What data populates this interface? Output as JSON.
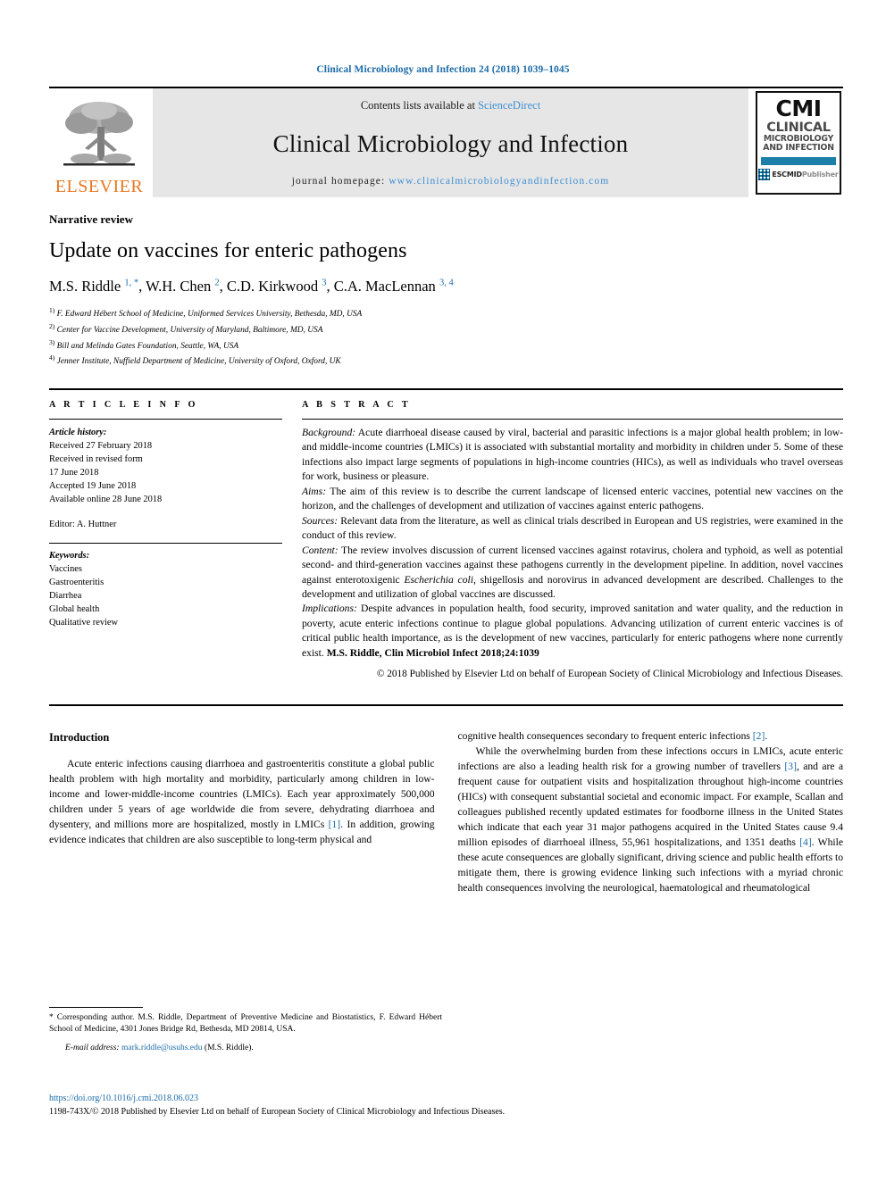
{
  "running_head": "Clinical Microbiology and Infection 24 (2018) 1039–1045",
  "masthead": {
    "publisher_logo_text": "ELSEVIER",
    "contents_prefix": "Contents lists available at ",
    "contents_link": "ScienceDirect",
    "journal_name": "Clinical Microbiology and Infection",
    "homepage_prefix": "journal homepage: ",
    "homepage_url": "www.clinicalmicrobiologyandinfection.com",
    "cmi_logo": {
      "acronym": "CMI",
      "line1": "CLINICAL",
      "line2": "MICROBIOLOGY",
      "line3": "AND INFECTION",
      "society": "ESCMID",
      "society_suffix": "Publisher"
    }
  },
  "article": {
    "kicker": "Narrative review",
    "title": "Update on vaccines for enteric pathogens",
    "authors_html": "M.S. Riddle, W.H. Chen, C.D. Kirkwood, C.A. MacLennan",
    "author_list": [
      {
        "name": "M.S. Riddle",
        "marks": "1, *"
      },
      {
        "name": "W.H. Chen",
        "marks": "2"
      },
      {
        "name": "C.D. Kirkwood",
        "marks": "3"
      },
      {
        "name": "C.A. MacLennan",
        "marks": "3, 4"
      }
    ],
    "affiliations": [
      {
        "num": "1)",
        "text": "F. Edward Hébert School of Medicine, Uniformed Services University, Bethesda, MD, USA"
      },
      {
        "num": "2)",
        "text": "Center for Vaccine Development, University of Maryland, Baltimore, MD, USA"
      },
      {
        "num": "3)",
        "text": "Bill and Melinda Gates Foundation, Seattle, WA, USA"
      },
      {
        "num": "4)",
        "text": "Jenner Institute, Nuffield Department of Medicine, University of Oxford, Oxford, UK"
      }
    ]
  },
  "article_info": {
    "heading": "A R T I C L E   I N F O",
    "history_label": "Article history:",
    "history_lines": [
      "Received 27 February 2018",
      "Received in revised form",
      "17 June 2018",
      "Accepted 19 June 2018",
      "Available online 28 June 2018"
    ],
    "editor": "Editor: A. Huttner",
    "keywords_label": "Keywords:",
    "keywords": [
      "Vaccines",
      "Gastroenteritis",
      "Diarrhea",
      "Global health",
      "Qualitative review"
    ]
  },
  "abstract": {
    "heading": "A B S T R A C T",
    "background_label": "Background:",
    "background": " Acute diarrhoeal disease caused by viral, bacterial and parasitic infections is a major global health problem; in low- and middle-income countries (LMICs) it is associated with substantial mortality and morbidity in children under 5. Some of these infections also impact large segments of populations in high-income countries (HICs), as well as individuals who travel overseas for work, business or pleasure.",
    "aims_label": "Aims:",
    "aims": " The aim of this review is to describe the current landscape of licensed enteric vaccines, potential new vaccines on the horizon, and the challenges of development and utilization of vaccines against enteric pathogens.",
    "sources_label": "Sources:",
    "sources": " Relevant data from the literature, as well as clinical trials described in European and US registries, were examined in the conduct of this review.",
    "content_label": "Content:",
    "content_part1": " The review involves discussion of current licensed vaccines against rotavirus, cholera and typhoid, as well as potential second- and third-generation vaccines against these pathogens currently in the development pipeline. In addition, novel vaccines against enterotoxigenic ",
    "content_italic": "Escherichia coli",
    "content_part2": ", shigellosis and norovirus in advanced development are described. Challenges to the development and utilization of global vaccines are discussed.",
    "implications_label": "Implications:",
    "implications": " Despite advances in population health, food security, improved sanitation and water quality, and the reduction in poverty, acute enteric infections continue to plague global populations. Advancing utilization of current enteric vaccines is of critical public health importance, as is the development of new vaccines, particularly for enteric pathogens where none currently exist. ",
    "citation_bold": "M.S. Riddle, Clin Microbiol Infect 2018;24:1039",
    "copyright": "© 2018 Published by Elsevier Ltd on behalf of European Society of Clinical Microbiology and Infectious Diseases."
  },
  "body": {
    "section_heading": "Introduction",
    "left_column": [
      {
        "parts": [
          {
            "t": "Acute enteric infections causing diarrhoea and gastroenteritis constitute a global public health problem with high mortality and morbidity, particularly among children in low-income and lower-middle-income countries (LMICs). Each year approximately 500,000 children under 5 years of age worldwide die from severe, dehydrating diarrhoea and dysentery, and millions more are hospitalized, mostly in LMICs ",
            "k": "text"
          },
          {
            "t": "[1]",
            "k": "ref"
          },
          {
            "t": ". In addition, growing evidence indicates that children are also susceptible to long-term physical and",
            "k": "text"
          }
        ]
      }
    ],
    "right_column": [
      {
        "parts": [
          {
            "t": "cognitive health consequences secondary to frequent enteric infections ",
            "k": "text"
          },
          {
            "t": "[2]",
            "k": "ref"
          },
          {
            "t": ".",
            "k": "text"
          }
        ],
        "indent": false
      },
      {
        "parts": [
          {
            "t": "While the overwhelming burden from these infections occurs in LMICs, acute enteric infections are also a leading health risk for a growing number of travellers ",
            "k": "text"
          },
          {
            "t": "[3]",
            "k": "ref"
          },
          {
            "t": ", and are a frequent cause for outpatient visits and hospitalization throughout high-income countries (HICs) with consequent substantial societal and economic impact. For example, Scallan and colleagues published recently updated estimates for foodborne illness in the United States which indicate that each year 31 major pathogens acquired in the United States cause 9.4 million episodes of diarrhoeal illness, 55,961 hospitalizations, and 1351 deaths ",
            "k": "text"
          },
          {
            "t": "[4]",
            "k": "ref"
          },
          {
            "t": ". While these acute consequences are globally significant, driving science and public health efforts to mitigate them, there is growing evidence linking such infections with a myriad chronic health consequences involving the neurological, haematological and rheumatological",
            "k": "text"
          }
        ],
        "indent": true
      }
    ]
  },
  "footnote": {
    "corresponding": "* Corresponding author. M.S. Riddle, Department of Preventive Medicine and Biostatistics, F. Edward Hébert School of Medicine, 4301 Jones Bridge Rd, Bethesda, MD 20814, USA.",
    "email_label": "E-mail address:",
    "email": "mark.riddle@usuhs.edu",
    "email_owner": "(M.S. Riddle)."
  },
  "page_footer": {
    "doi": "https://doi.org/10.1016/j.cmi.2018.06.023",
    "issn_line": "1198-743X/© 2018 Published by Elsevier Ltd on behalf of European Society of Clinical Microbiology and Infectious Diseases."
  },
  "colors": {
    "link_blue": "#1b6ba8",
    "sciencedirect_blue": "#3f8fd2",
    "elsevier_orange": "#e87722",
    "cmi_bar_blue": "#1b7fa8",
    "masthead_grey": "#e6e6e6"
  }
}
